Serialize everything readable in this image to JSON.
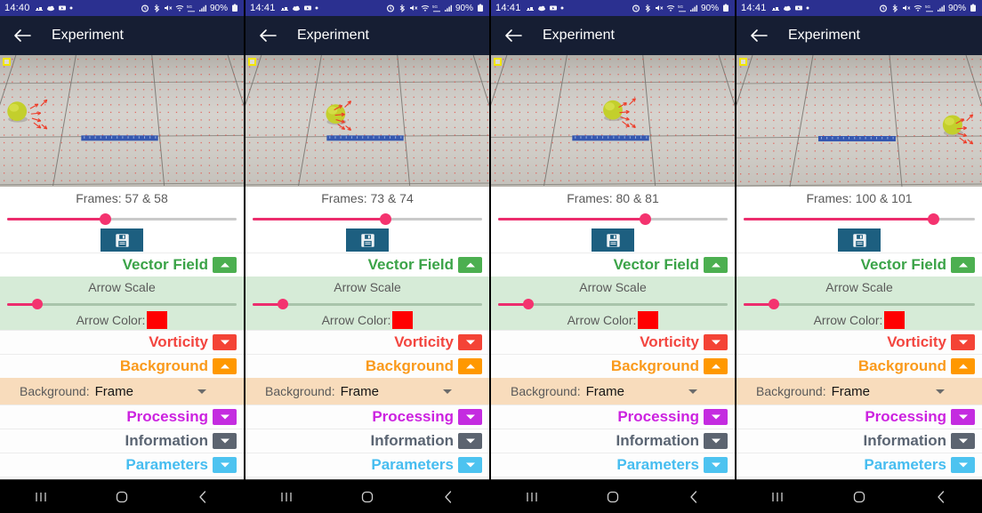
{
  "app": {
    "title": "Experiment",
    "back_icon": "back-arrow-icon"
  },
  "status_bar": {
    "times": [
      "14:40",
      "14:41",
      "14:41",
      "14:41"
    ],
    "battery": "90%",
    "left_icons": [
      "weather-icon",
      "cloud-icon",
      "video-icon",
      "dot-icon"
    ],
    "right_icons": [
      "alarm-icon",
      "bluetooth-icon",
      "mute-icon",
      "wifi-icon",
      "signal-icon",
      "cellular-icon"
    ]
  },
  "panels": [
    {
      "frames_label": "Frames: 57 & 58",
      "frame_slider_pct": 43,
      "ball_x_pct": 7,
      "ball_y_pct": 43,
      "arrows_x_pct": 16,
      "arrows_y_pct": 45
    },
    {
      "frames_label": "Frames: 73 & 74",
      "frame_slider_pct": 58,
      "ball_x_pct": 37,
      "ball_y_pct": 45,
      "arrows_x_pct": 40,
      "arrows_y_pct": 46
    },
    {
      "frames_label": "Frames: 80 & 81",
      "frame_slider_pct": 64,
      "ball_x_pct": 50,
      "ball_y_pct": 42,
      "arrows_x_pct": 56,
      "arrows_y_pct": 44
    },
    {
      "frames_label": "Frames: 100 & 101",
      "frame_slider_pct": 82,
      "ball_x_pct": 88,
      "ball_y_pct": 53,
      "arrows_x_pct": 93,
      "arrows_y_pct": 56
    }
  ],
  "controls": {
    "save_icon": "save-floppy-icon",
    "vector_field": {
      "label": "Vector Field",
      "expanded": true,
      "chevron": "chevron-up-icon",
      "arrow_scale_label": "Arrow Scale",
      "arrow_scale_pct": 13,
      "arrow_color_label": "Arrow Color:",
      "arrow_color": "#FF0000"
    },
    "vorticity": {
      "label": "Vorticity",
      "expanded": false,
      "chevron": "chevron-down-icon",
      "color": "#F44336"
    },
    "background": {
      "label": "Background",
      "expanded": true,
      "chevron": "chevron-up-icon",
      "color": "#FF9800",
      "field_label": "Background:",
      "field_value": "Frame",
      "field_caret": "caret-down-icon"
    },
    "processing": {
      "label": "Processing",
      "expanded": false,
      "chevron": "chevron-down-icon",
      "color": "#C42CE0"
    },
    "information": {
      "label": "Information",
      "expanded": false,
      "chevron": "chevron-down-icon",
      "color": "#5C6470"
    },
    "parameters": {
      "label": "Parameters",
      "expanded": false,
      "chevron": "chevron-down-icon",
      "color": "#4DC3F0"
    }
  },
  "nav_bar": {
    "recents_icon": "recents-icon",
    "home_icon": "home-icon",
    "back_icon": "nav-back-icon"
  }
}
